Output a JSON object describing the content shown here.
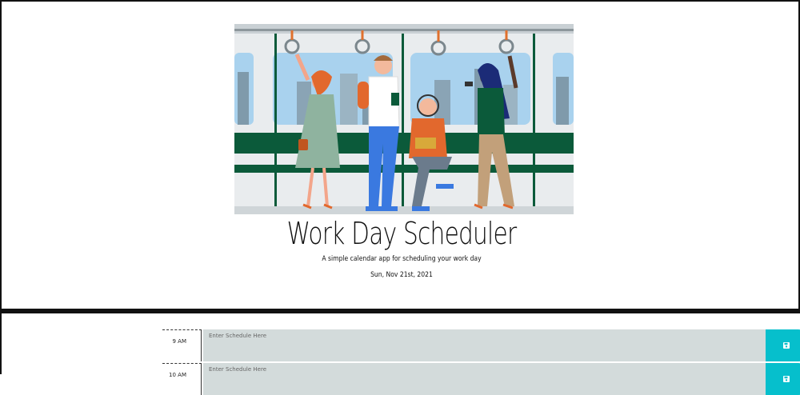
{
  "header": {
    "title": "Work Day Scheduler",
    "lead": "A simple calendar app for scheduling your work day",
    "current_date": "Sun, Nov 21st, 2021"
  },
  "hero_image": {
    "icon": "commuters-illustration"
  },
  "schedule": {
    "rows": [
      {
        "hour": "9 AM",
        "placeholder": "Enter Schedule Here",
        "save_icon": "floppy-disk-icon"
      },
      {
        "hour": "10 AM",
        "placeholder": "Enter Schedule Here",
        "save_icon": "floppy-disk-icon"
      }
    ]
  },
  "colors": {
    "save_button": "#06bfcc",
    "textarea_bg": "#d3dbdb",
    "divider": "#111111"
  }
}
